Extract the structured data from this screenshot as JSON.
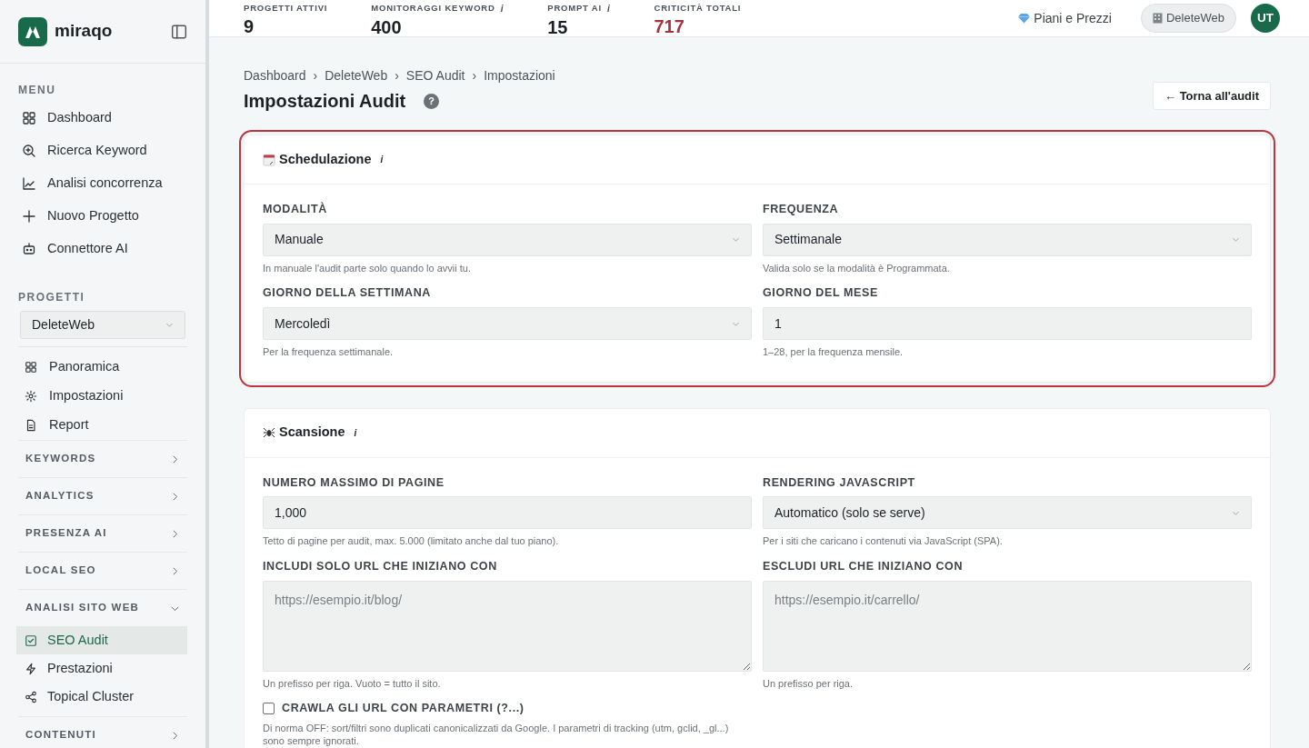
{
  "sidebar": {
    "logo_text": "miraqo",
    "menu_heading": "MENU",
    "menu": [
      {
        "label": "Dashboard"
      },
      {
        "label": "Ricerca Keyword"
      },
      {
        "label": "Analisi concorrenza"
      },
      {
        "label": "Nuovo Progetto"
      },
      {
        "label": "Connettore AI"
      }
    ],
    "projects_heading": "PROGETTI",
    "project_select": "DeleteWeb",
    "project_items": [
      {
        "label": "Panoramica"
      },
      {
        "label": "Impostazioni"
      },
      {
        "label": "Report"
      }
    ],
    "sections": [
      {
        "label": "KEYWORDS",
        "expanded": false
      },
      {
        "label": "ANALYTICS",
        "expanded": false
      },
      {
        "label": "PRESENZA AI",
        "expanded": false
      },
      {
        "label": "LOCAL SEO",
        "expanded": false
      },
      {
        "label": "ANALISI SITO WEB",
        "expanded": true,
        "children": [
          {
            "label": "SEO Audit",
            "selected": true
          },
          {
            "label": "Prestazioni",
            "selected": false
          },
          {
            "label": "Topical Cluster",
            "selected": false
          }
        ]
      },
      {
        "label": "CONTENUTI",
        "expanded": false
      }
    ]
  },
  "stats": [
    {
      "label": "PROGETTI ATTIVI",
      "value": "9",
      "alert": false
    },
    {
      "label": "MONITORAGGI KEYWORD",
      "info": "i",
      "value": "400",
      "alert": false
    },
    {
      "label": "PROMPT AI",
      "info": "i",
      "value": "15",
      "alert": false
    },
    {
      "label": "CRITICITÀ TOTALI",
      "value": "717",
      "alert": true
    }
  ],
  "topbar": {
    "plans_link": "Piani e Prezzi",
    "workspace": "DeleteWeb",
    "avatar": "UT"
  },
  "breadcrumb": [
    "Dashboard",
    "DeleteWeb",
    "SEO Audit",
    "Impostazioni"
  ],
  "breadcrumb_separator": "›",
  "title": "Impostazioni Audit",
  "help_mark": "?",
  "back_button": "← Torna all'audit",
  "cards": [
    {
      "title": "Schedulazione",
      "info": "i",
      "highlighted": true,
      "fields": [
        {
          "label": "MODALITÀ",
          "kind": "select",
          "value": "Manuale",
          "help": "In manuale l'audit parte solo quando lo avvii tu."
        },
        {
          "label": "FREQUENZA",
          "kind": "select",
          "value": "Settimanale",
          "help": "Valida solo se la modalità è Programmata."
        },
        {
          "label": "GIORNO DELLA SETTIMANA",
          "kind": "select",
          "value": "Mercoledì",
          "help": "Per la frequenza settimanale."
        },
        {
          "label": "GIORNO DEL MESE",
          "kind": "input",
          "value": "1",
          "help": "1–28, per la frequenza mensile."
        }
      ]
    },
    {
      "title": "Scansione",
      "info": "i",
      "highlighted": false,
      "fields": [
        {
          "label": "NUMERO MASSIMO DI PAGINE",
          "kind": "input",
          "value": "1,000",
          "help": "Tetto di pagine per audit, max. 5.000 (limitato anche dal tuo piano)."
        },
        {
          "label": "RENDERING JAVASCRIPT",
          "kind": "select",
          "value": "Automatico (solo se serve)",
          "help": "Per i siti che caricano i contenuti via JavaScript (SPA)."
        },
        {
          "label": "INCLUDI SOLO URL CHE INIZIANO CON",
          "kind": "textarea",
          "placeholder": "https://esempio.it/blog/",
          "help": "Un prefisso per riga. Vuoto = tutto il sito."
        },
        {
          "label": "ESCLUDI URL CHE INIZIANO CON",
          "kind": "textarea",
          "placeholder": "https://esempio.it/carrello/",
          "help": "Un prefisso per riga."
        }
      ],
      "checkbox": {
        "label": "CRAWLA GLI URL CON PARAMETRI (?...)",
        "checked": false,
        "help": "Di norma OFF: sort/filtri sono duplicati canonicalizzati da Google. I parametri di tracking (utm, gclid, _gl...) sono sempre ignorati."
      }
    }
  ]
}
